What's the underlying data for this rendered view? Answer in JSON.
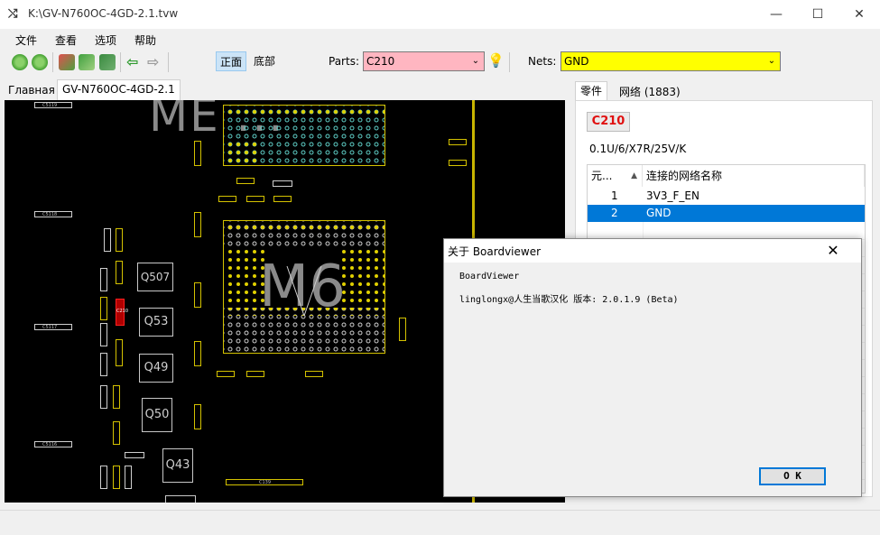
{
  "window": {
    "title": "K:\\GV-N760OC-4GD-2.1.tvw",
    "minimize": "—",
    "maximize": "☐",
    "close": "✕"
  },
  "menu": [
    "文件",
    "查看",
    "选项",
    "帮助"
  ],
  "toolbar": {
    "front_label": "正面",
    "bottom_label": "底部",
    "parts_label": "Parts:",
    "parts_value": "C210",
    "nets_label": "Nets:",
    "nets_value": "GND",
    "colors": {
      "parts_bg": "#ffb6c1",
      "nets_bg": "#ffff00",
      "accent": "#0078d7"
    }
  },
  "tabs": [
    "Главная",
    "GV-N760OC-4GD-2.1"
  ],
  "board": {
    "watermark_1": "ME ...",
    "watermark_2": "M6",
    "components": {
      "q1": "Q507",
      "q2": "Q53",
      "q3": "Q49",
      "q4": "Q50",
      "q5": "Q43",
      "c1": "C5119",
      "c2": "C5118",
      "c3": "C5117",
      "c4": "C5116",
      "c5": "C139",
      "highlight": "C210"
    }
  },
  "right_panel": {
    "tabs": [
      "零件",
      "网络 (1883)"
    ],
    "part_name": "C210",
    "part_value": "0.1U/6/X7R/25V/K",
    "table": {
      "headers": [
        "元...",
        "连接的网络名称"
      ],
      "rows": [
        {
          "pin": "1",
          "net": "3V3_F_EN"
        },
        {
          "pin": "2",
          "net": "GND"
        }
      ]
    }
  },
  "dialog": {
    "title": "关于 Boardviewer",
    "line1": "BoardViewer",
    "line2": "linglongx@人生当歌汉化  版本: 2.0.1.9 (Beta)",
    "ok": "O K"
  }
}
